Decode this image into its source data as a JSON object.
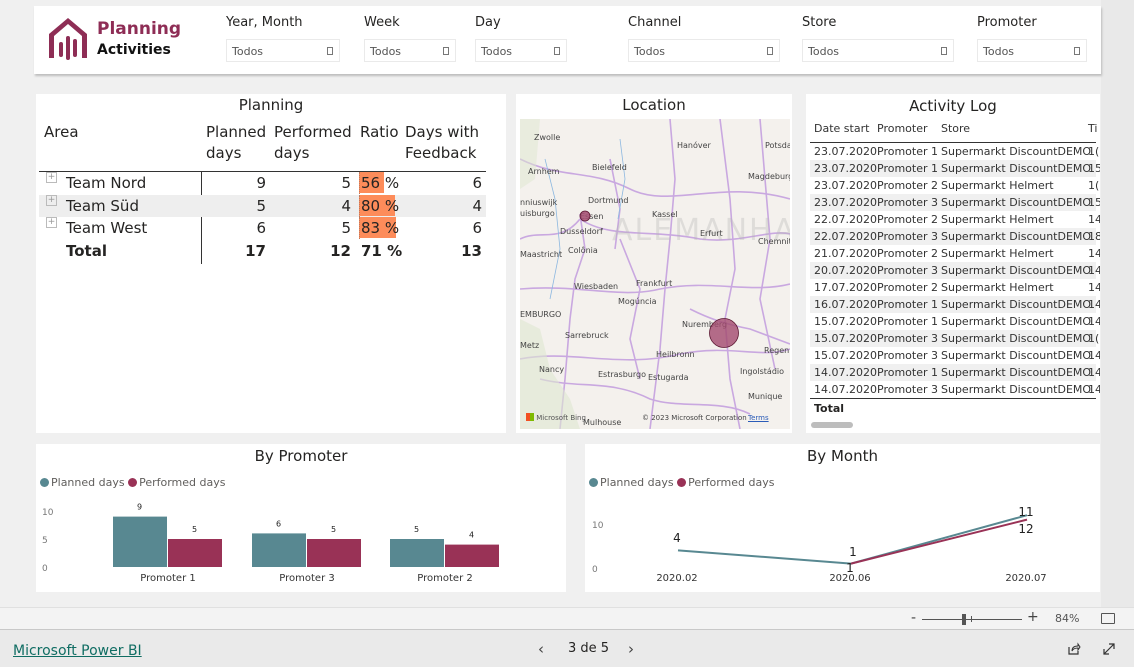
{
  "header": {
    "brand_line1": "Planning",
    "brand_line2": "Activities",
    "brand_color": "#8e2d55",
    "logo_icon": "building-chart-icon",
    "slicers": [
      {
        "label": "Year, Month",
        "value": "Todos"
      },
      {
        "label": "Week",
        "value": "Todos"
      },
      {
        "label": "Day",
        "value": "Todos"
      },
      {
        "label": "Channel",
        "value": "Todos"
      },
      {
        "label": "Store",
        "value": "Todos"
      },
      {
        "label": "Promoter",
        "value": "Todos"
      }
    ]
  },
  "planning": {
    "title": "Planning",
    "columns": {
      "area": "Area",
      "planned_l1": "Planned",
      "planned_l2": "days",
      "performed_l1": "Performed",
      "performed_l2": "days",
      "ratio": "Ratio",
      "feedback_l1": "Days with",
      "feedback_l2": "Feedback"
    },
    "rows": [
      {
        "area": "Team Nord",
        "planned": "9",
        "performed": "5",
        "ratio": "56 %",
        "ratio_value": 0.56,
        "feedback": "6"
      },
      {
        "area": "Team Süd",
        "planned": "5",
        "performed": "4",
        "ratio": "80 %",
        "ratio_value": 0.8,
        "feedback": "4"
      },
      {
        "area": "Team West",
        "planned": "6",
        "performed": "5",
        "ratio": "83 %",
        "ratio_value": 0.83,
        "feedback": "6"
      }
    ],
    "total": {
      "area": "Total",
      "planned": "17",
      "performed": "12",
      "ratio": "71 %",
      "feedback": "13"
    },
    "ratio_bar_color": "#fd8c5a"
  },
  "location": {
    "title": "Location",
    "country_label": "ALEMANHA",
    "cities": [
      "Zwolle",
      "Hanóver",
      "Potsda",
      "Arnhem",
      "Bielefeld",
      "Magdeburg",
      "nniuswijk",
      "Dortmund",
      "uisburgo",
      "Essen",
      "Kassel",
      "Dusseldorf",
      "Erfurt",
      "Chemnit",
      "Colônia",
      "Maastricht",
      "Wiesbaden",
      "Frankfurt",
      "Mogúncia",
      "EMBURGO",
      "Nuremberg",
      "Sarrebruck",
      "Metz",
      "Heilbronn",
      "Regen",
      "Nancy",
      "Estrasburgo",
      "Estugarda",
      "Ingolstádio",
      "Munique",
      "Mulhouse"
    ],
    "markers": [
      {
        "name": "Essen",
        "size": "small"
      },
      {
        "name": "Nuremberg",
        "size": "large"
      }
    ],
    "attribution_logo": "Microsoft Bing",
    "copyright": "© 2023 Microsoft Corporation",
    "terms": "Terms"
  },
  "activity_log": {
    "title": "Activity Log",
    "columns": [
      "Date start",
      "Promoter",
      "Store",
      "Ti"
    ],
    "rows": [
      [
        "23.07.2020",
        "Promoter 1",
        "Supermarkt DiscountDEMO",
        "1("
      ],
      [
        "23.07.2020",
        "Promoter 1",
        "Supermarkt DiscountDEMO",
        "15"
      ],
      [
        "23.07.2020",
        "Promoter 2",
        "Supermarkt Helmert",
        "1("
      ],
      [
        "23.07.2020",
        "Promoter 3",
        "Supermarkt DiscountDEMO",
        "15"
      ],
      [
        "22.07.2020",
        "Promoter 2",
        "Supermarkt Helmert",
        "14"
      ],
      [
        "22.07.2020",
        "Promoter 3",
        "Supermarkt DiscountDEMO",
        "18"
      ],
      [
        "21.07.2020",
        "Promoter 2",
        "Supermarkt Helmert",
        "14"
      ],
      [
        "20.07.2020",
        "Promoter 3",
        "Supermarkt DiscountDEMO",
        "14"
      ],
      [
        "17.07.2020",
        "Promoter 2",
        "Supermarkt Helmert",
        "14"
      ],
      [
        "16.07.2020",
        "Promoter 1",
        "Supermarkt DiscountDEMO",
        "14"
      ],
      [
        "15.07.2020",
        "Promoter 1",
        "Supermarkt DiscountDEMO",
        "14"
      ],
      [
        "15.07.2020",
        "Promoter 3",
        "Supermarkt DiscountDEMO",
        "1("
      ],
      [
        "15.07.2020",
        "Promoter 3",
        "Supermarkt DiscountDEMO",
        "14"
      ],
      [
        "14.07.2020",
        "Promoter 1",
        "Supermarkt DiscountDEMO",
        "14"
      ],
      [
        "14.07.2020",
        "Promoter 3",
        "Supermarkt DiscountDEMO",
        "14"
      ]
    ],
    "total_label": "Total"
  },
  "chart_data": [
    {
      "type": "bar",
      "title": "By Promoter",
      "categories": [
        "Promoter 1",
        "Promoter 3",
        "Promoter 2"
      ],
      "series": [
        {
          "name": "Planned days",
          "color": "#588891",
          "values": [
            9,
            6,
            5
          ]
        },
        {
          "name": "Performed days",
          "color": "#993256",
          "values": [
            5,
            5,
            4
          ]
        }
      ],
      "yticks": [
        "0",
        "5",
        "10"
      ],
      "ylim": [
        0,
        10
      ],
      "legend": "top-left",
      "grid": false,
      "xlabel": "",
      "ylabel": ""
    },
    {
      "type": "line",
      "title": "By Month",
      "categories": [
        "2020.02",
        "2020.06",
        "2020.07"
      ],
      "series": [
        {
          "name": "Planned days",
          "color": "#588891",
          "values": [
            4,
            1,
            12
          ],
          "labels": [
            "4",
            "1",
            "12"
          ]
        },
        {
          "name": "Performed days",
          "color": "#993256",
          "values": [
            null,
            1,
            11
          ],
          "labels": [
            "",
            "1",
            "11"
          ]
        }
      ],
      "yticks": [
        "0",
        "10"
      ],
      "ylim": [
        0,
        12
      ],
      "legend": "top-left",
      "grid": false,
      "xlabel": "",
      "ylabel": ""
    }
  ],
  "zoom": {
    "minus": "-",
    "plus": "+",
    "percent": "84%",
    "value": 0.84
  },
  "footer": {
    "link": "Microsoft Power BI",
    "prev": "‹",
    "page": "3 de 5",
    "next": "›",
    "share_icon": "share-icon",
    "fullscreen_icon": "expand-icon"
  }
}
